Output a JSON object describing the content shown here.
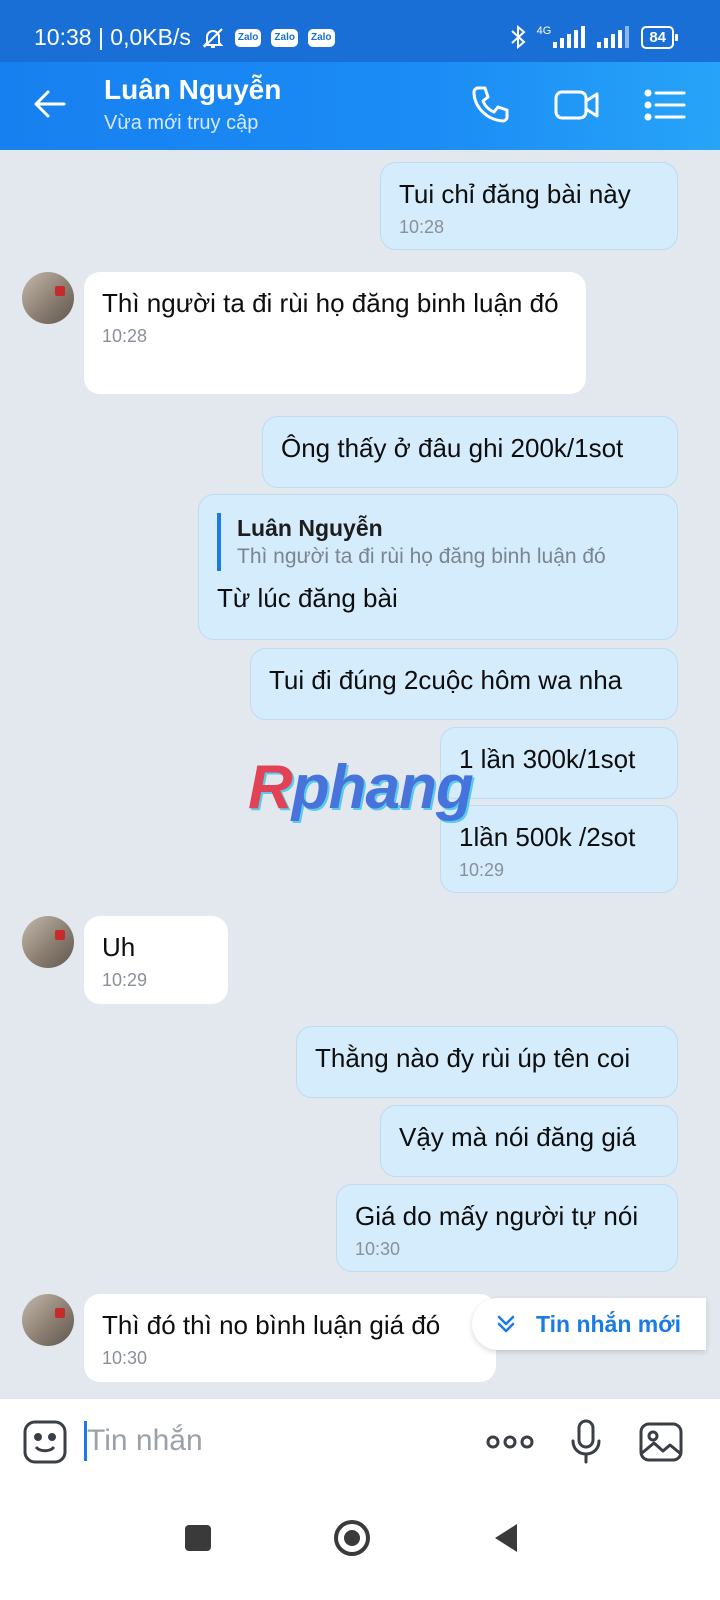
{
  "status_bar": {
    "time_speed": "10:38 | 0,0KB/s",
    "zalo_badges": [
      "Zalo",
      "Zalo",
      "Zalo"
    ],
    "network": "4G",
    "battery": "84"
  },
  "header": {
    "contact_name": "Luân Nguyễn",
    "contact_status": "Vừa mới truy cập"
  },
  "messages": [
    {
      "text": "Tui chỉ đăng bài này",
      "time": "10:28"
    },
    {
      "text": "Thì người ta đi rùi họ đăng binh luận đó",
      "time": "10:28"
    },
    {
      "text": "Ông thấy ở đâu ghi 200k/1sot"
    },
    {
      "quote_name": "Luân Nguyễn",
      "quote_text": "Thì người ta đi rùi họ đăng binh luận đó",
      "text": "Từ lúc đăng bài"
    },
    {
      "text": "Tui đi đúng 2cuộc hôm wa nha"
    },
    {
      "text": "1 lần 300k/1sọt"
    },
    {
      "text": "1lần 500k /2sot",
      "time": "10:29"
    },
    {
      "text": "Uh",
      "time": "10:29"
    },
    {
      "text": "Thằng nào đy rùi úp tên coi"
    },
    {
      "text": "Vậy mà nói đăng giá"
    },
    {
      "text": "Giá do mấy người tự nói",
      "time": "10:30"
    },
    {
      "text": "Thì đó thì no bình luận giá đó",
      "time": "10:30"
    }
  ],
  "watermark": {
    "first": "R",
    "rest": "phang"
  },
  "new_message_pill": "Tin nhắn mới",
  "composer": {
    "placeholder": "Tin nhắn"
  },
  "colors": {
    "primary": "#1a6fd6",
    "outgoing_bubble": "#d4ecfb",
    "chat_background": "#e2e8ee"
  }
}
